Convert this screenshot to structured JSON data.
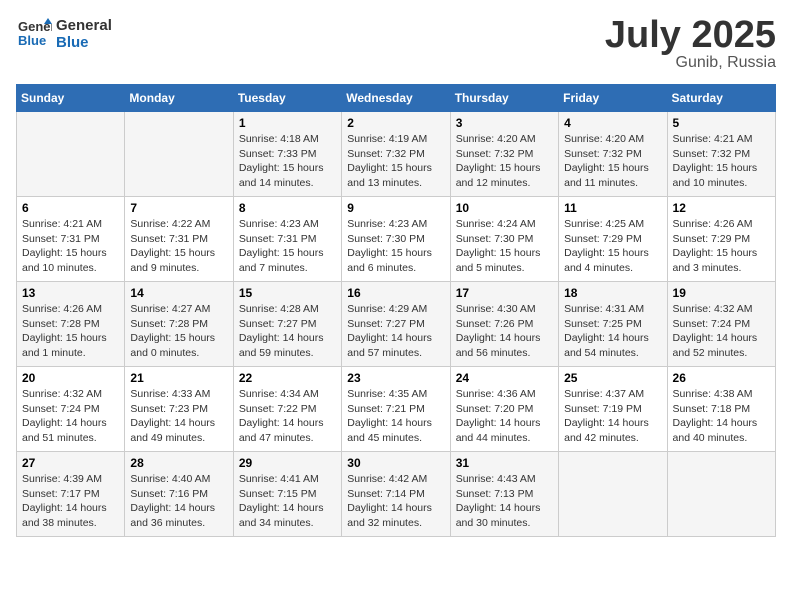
{
  "header": {
    "logo_line1": "General",
    "logo_line2": "Blue",
    "month": "July 2025",
    "location": "Gunib, Russia"
  },
  "weekdays": [
    "Sunday",
    "Monday",
    "Tuesday",
    "Wednesday",
    "Thursday",
    "Friday",
    "Saturday"
  ],
  "weeks": [
    [
      {
        "day": "",
        "info": ""
      },
      {
        "day": "",
        "info": ""
      },
      {
        "day": "1",
        "info": "Sunrise: 4:18 AM\nSunset: 7:33 PM\nDaylight: 15 hours\nand 14 minutes."
      },
      {
        "day": "2",
        "info": "Sunrise: 4:19 AM\nSunset: 7:32 PM\nDaylight: 15 hours\nand 13 minutes."
      },
      {
        "day": "3",
        "info": "Sunrise: 4:20 AM\nSunset: 7:32 PM\nDaylight: 15 hours\nand 12 minutes."
      },
      {
        "day": "4",
        "info": "Sunrise: 4:20 AM\nSunset: 7:32 PM\nDaylight: 15 hours\nand 11 minutes."
      },
      {
        "day": "5",
        "info": "Sunrise: 4:21 AM\nSunset: 7:32 PM\nDaylight: 15 hours\nand 10 minutes."
      }
    ],
    [
      {
        "day": "6",
        "info": "Sunrise: 4:21 AM\nSunset: 7:31 PM\nDaylight: 15 hours\nand 10 minutes."
      },
      {
        "day": "7",
        "info": "Sunrise: 4:22 AM\nSunset: 7:31 PM\nDaylight: 15 hours\nand 9 minutes."
      },
      {
        "day": "8",
        "info": "Sunrise: 4:23 AM\nSunset: 7:31 PM\nDaylight: 15 hours\nand 7 minutes."
      },
      {
        "day": "9",
        "info": "Sunrise: 4:23 AM\nSunset: 7:30 PM\nDaylight: 15 hours\nand 6 minutes."
      },
      {
        "day": "10",
        "info": "Sunrise: 4:24 AM\nSunset: 7:30 PM\nDaylight: 15 hours\nand 5 minutes."
      },
      {
        "day": "11",
        "info": "Sunrise: 4:25 AM\nSunset: 7:29 PM\nDaylight: 15 hours\nand 4 minutes."
      },
      {
        "day": "12",
        "info": "Sunrise: 4:26 AM\nSunset: 7:29 PM\nDaylight: 15 hours\nand 3 minutes."
      }
    ],
    [
      {
        "day": "13",
        "info": "Sunrise: 4:26 AM\nSunset: 7:28 PM\nDaylight: 15 hours\nand 1 minute."
      },
      {
        "day": "14",
        "info": "Sunrise: 4:27 AM\nSunset: 7:28 PM\nDaylight: 15 hours\nand 0 minutes."
      },
      {
        "day": "15",
        "info": "Sunrise: 4:28 AM\nSunset: 7:27 PM\nDaylight: 14 hours\nand 59 minutes."
      },
      {
        "day": "16",
        "info": "Sunrise: 4:29 AM\nSunset: 7:27 PM\nDaylight: 14 hours\nand 57 minutes."
      },
      {
        "day": "17",
        "info": "Sunrise: 4:30 AM\nSunset: 7:26 PM\nDaylight: 14 hours\nand 56 minutes."
      },
      {
        "day": "18",
        "info": "Sunrise: 4:31 AM\nSunset: 7:25 PM\nDaylight: 14 hours\nand 54 minutes."
      },
      {
        "day": "19",
        "info": "Sunrise: 4:32 AM\nSunset: 7:24 PM\nDaylight: 14 hours\nand 52 minutes."
      }
    ],
    [
      {
        "day": "20",
        "info": "Sunrise: 4:32 AM\nSunset: 7:24 PM\nDaylight: 14 hours\nand 51 minutes."
      },
      {
        "day": "21",
        "info": "Sunrise: 4:33 AM\nSunset: 7:23 PM\nDaylight: 14 hours\nand 49 minutes."
      },
      {
        "day": "22",
        "info": "Sunrise: 4:34 AM\nSunset: 7:22 PM\nDaylight: 14 hours\nand 47 minutes."
      },
      {
        "day": "23",
        "info": "Sunrise: 4:35 AM\nSunset: 7:21 PM\nDaylight: 14 hours\nand 45 minutes."
      },
      {
        "day": "24",
        "info": "Sunrise: 4:36 AM\nSunset: 7:20 PM\nDaylight: 14 hours\nand 44 minutes."
      },
      {
        "day": "25",
        "info": "Sunrise: 4:37 AM\nSunset: 7:19 PM\nDaylight: 14 hours\nand 42 minutes."
      },
      {
        "day": "26",
        "info": "Sunrise: 4:38 AM\nSunset: 7:18 PM\nDaylight: 14 hours\nand 40 minutes."
      }
    ],
    [
      {
        "day": "27",
        "info": "Sunrise: 4:39 AM\nSunset: 7:17 PM\nDaylight: 14 hours\nand 38 minutes."
      },
      {
        "day": "28",
        "info": "Sunrise: 4:40 AM\nSunset: 7:16 PM\nDaylight: 14 hours\nand 36 minutes."
      },
      {
        "day": "29",
        "info": "Sunrise: 4:41 AM\nSunset: 7:15 PM\nDaylight: 14 hours\nand 34 minutes."
      },
      {
        "day": "30",
        "info": "Sunrise: 4:42 AM\nSunset: 7:14 PM\nDaylight: 14 hours\nand 32 minutes."
      },
      {
        "day": "31",
        "info": "Sunrise: 4:43 AM\nSunset: 7:13 PM\nDaylight: 14 hours\nand 30 minutes."
      },
      {
        "day": "",
        "info": ""
      },
      {
        "day": "",
        "info": ""
      }
    ]
  ]
}
